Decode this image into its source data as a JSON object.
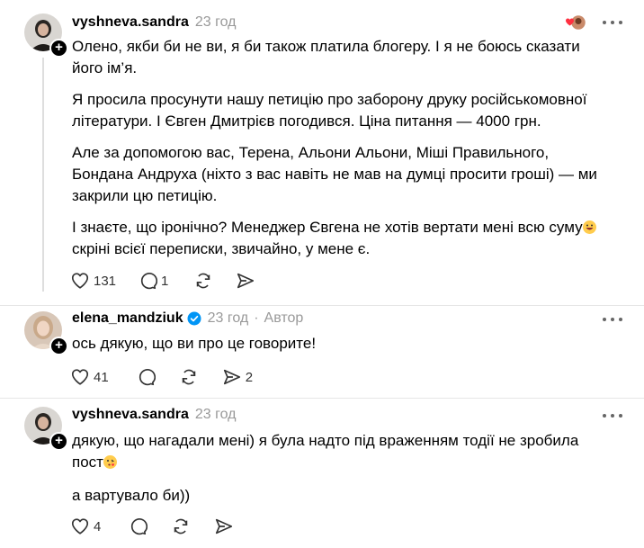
{
  "posts": [
    {
      "username": "vyshneva.sandra",
      "time": "23 год",
      "paragraphs": [
        "Олено, якби би не ви, я би також платила блогеру. І я не боюсь сказати його ім’я.",
        "Я просила просунути нашу петицію про заборону друку російськомовної літератури. І Євген Дмитрієв погодився. Ціна питання — 4000 грн.",
        "Але за допомогою вас, Терена, Альони Альони, Міші Правильного, Бондана Андруха (ніхто з вас навіть не мав на думці просити гроші) — ми закрили цю петицію.",
        "І знаєте, що іронічно? Менеджер Євгена не хотів вертати мені всю суму",
        "скріні всієї переписки, звичайно, у мене є."
      ],
      "likes": "131",
      "replies": "1"
    },
    {
      "username": "elena_mandziuk",
      "time": "23 год",
      "dot": "·",
      "author": "Автор",
      "paragraphs": [
        "ось дякую, що ви про це говорите!"
      ],
      "likes": "41",
      "shares": "2"
    },
    {
      "username": "vyshneva.sandra",
      "time": "23 год",
      "paragraphs": [
        "дякую, що нагадали мені) я була надто під враженням тодії не зробила",
        "пост",
        "а вартувало би))"
      ],
      "likes": "4"
    }
  ],
  "icons": {
    "like": "heart-icon",
    "reply": "comment-icon",
    "repost": "repost-icon",
    "share": "send-icon",
    "more": "more-icon",
    "verified": "verified-badge-icon",
    "follow": "plus-icon",
    "follow_glyph": "+"
  },
  "colors": {
    "verified": "#0095f6",
    "liked_heart": "#ff3040",
    "muted": "#999999"
  }
}
